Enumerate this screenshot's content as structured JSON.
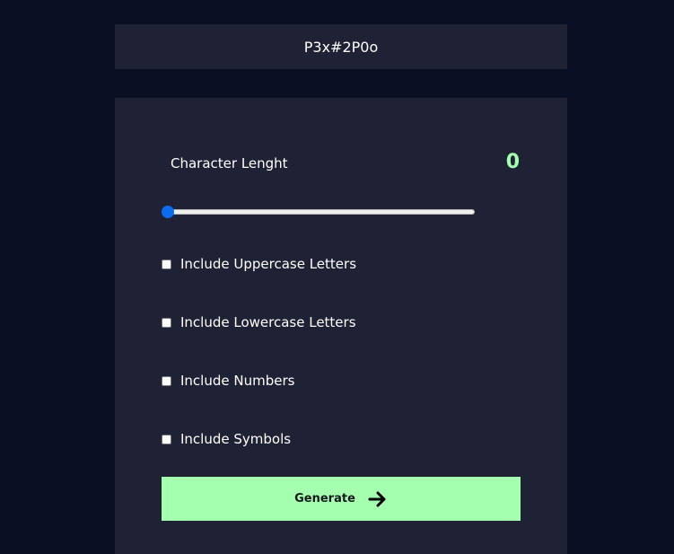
{
  "password": {
    "value": "P3x#2P0o"
  },
  "length": {
    "label": "Character Lenght",
    "value": "0",
    "slider_fraction": 0
  },
  "options": [
    {
      "label": "Include Uppercase Letters",
      "checked": false
    },
    {
      "label": "Include Lowercase Letters",
      "checked": false
    },
    {
      "label": "Include Numbers",
      "checked": false
    },
    {
      "label": "Include Symbols",
      "checked": false
    }
  ],
  "generate": {
    "label": "Generate",
    "icon": "arrow-right-icon"
  },
  "colors": {
    "background": "#0b0f24",
    "panel": "#1f2135",
    "accent": "#a4ffaf",
    "slider_thumb": "#0b6cf0"
  }
}
